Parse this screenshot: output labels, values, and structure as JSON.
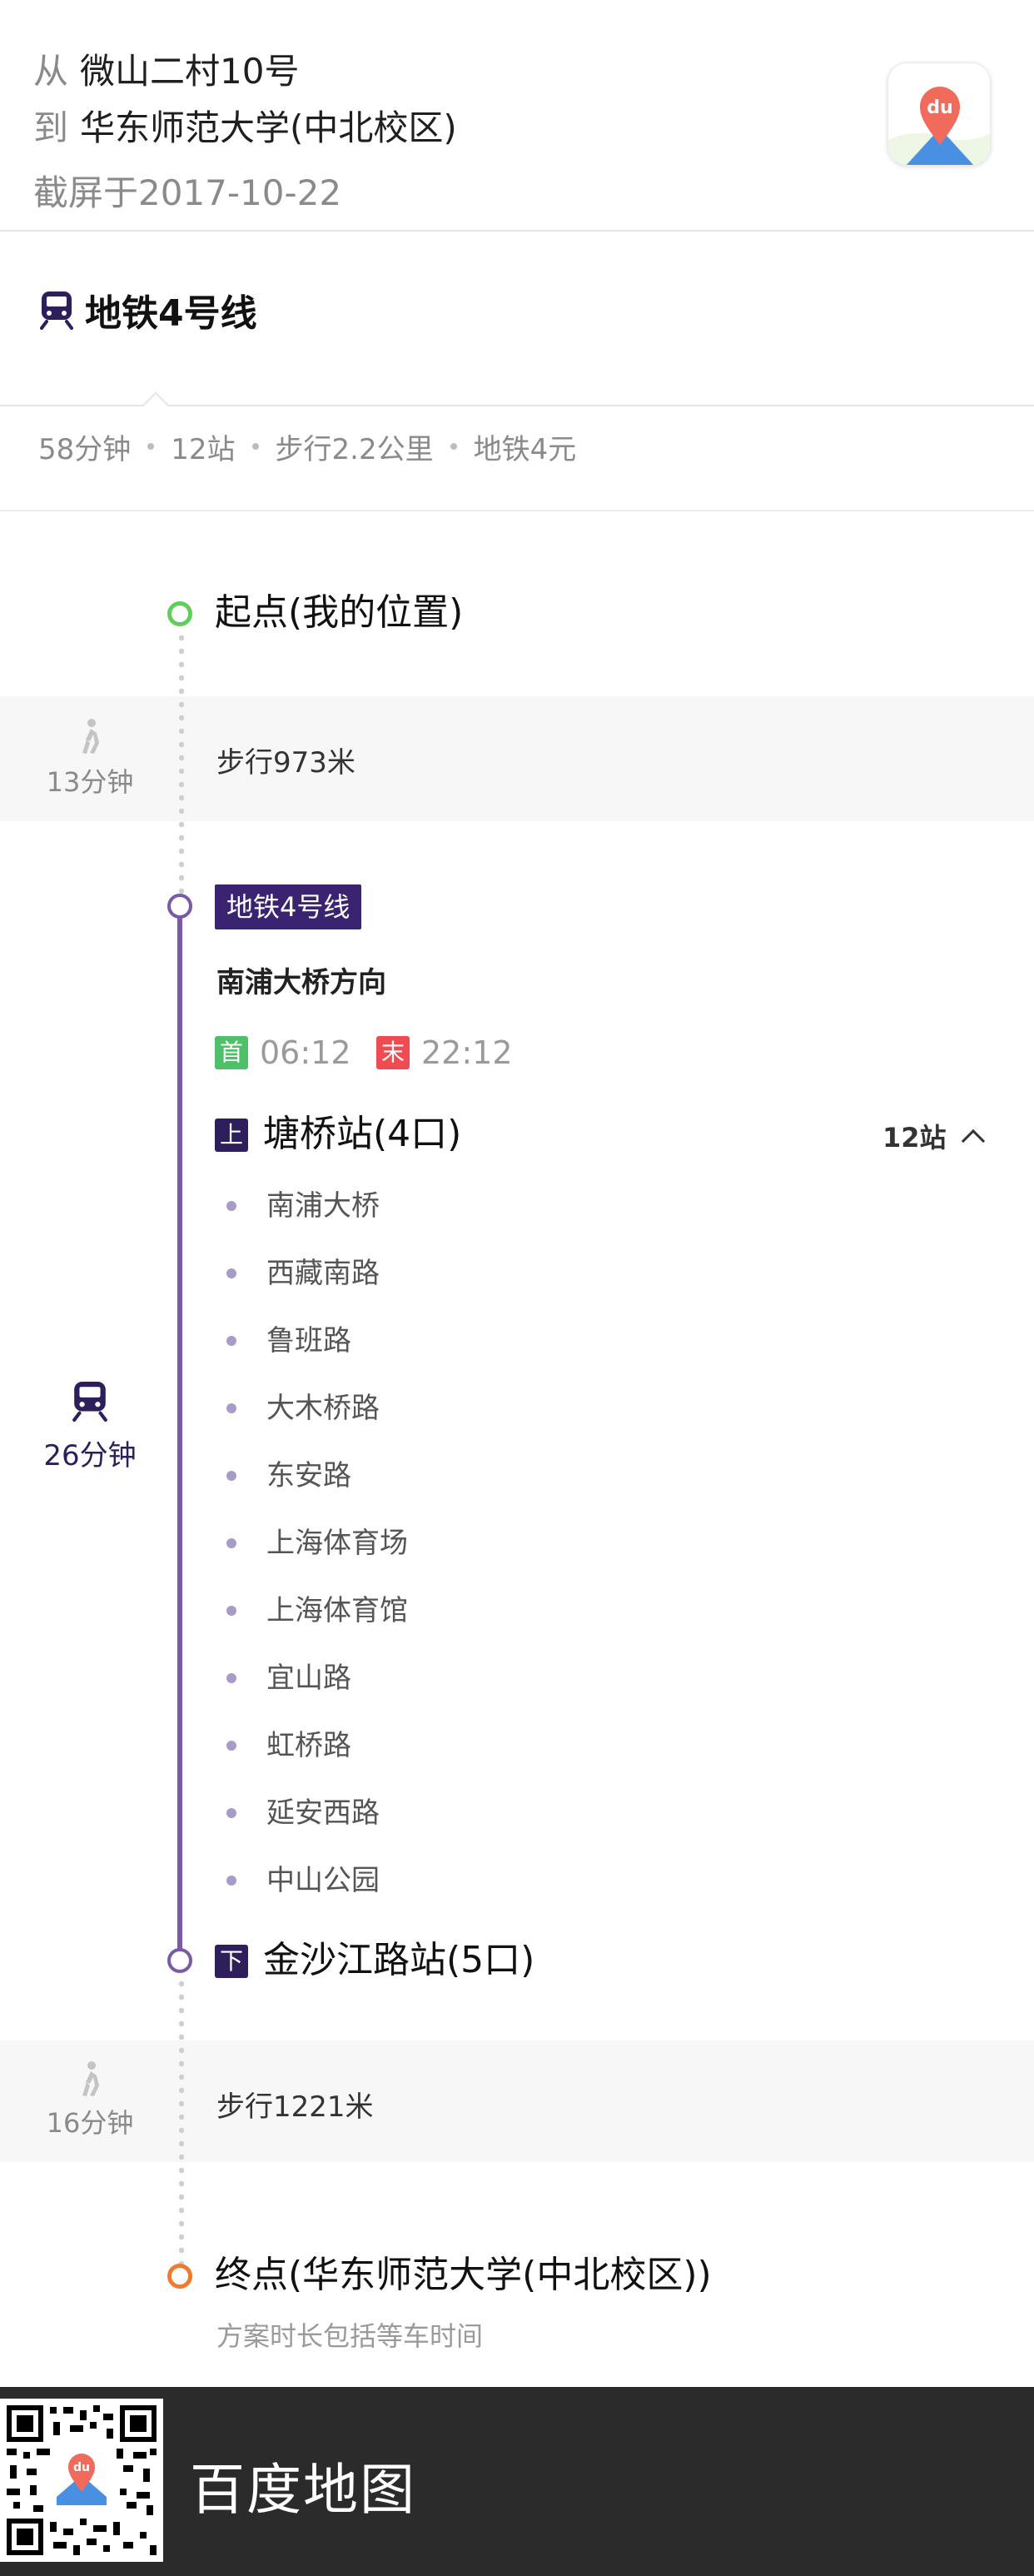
{
  "header": {
    "from_prefix": "从",
    "from_text": "微山二村10号",
    "to_prefix": "到",
    "to_text": "华东师范大学(中北校区)",
    "captured": "截屏于2017-10-22",
    "logo_text": "du"
  },
  "route": {
    "title": "地铁4号线",
    "summary": {
      "duration": "58分钟",
      "stops": "12站",
      "walk": "步行2.2公里",
      "fare": "地铁4元"
    }
  },
  "timeline": {
    "start_label": "起点(我的位置)",
    "walk1": {
      "time": "13分钟",
      "distance": "步行973米"
    },
    "metro": {
      "line": "地铁4号线",
      "direction": "南浦大桥方向",
      "first_label": "首",
      "first_time": "06:12",
      "last_label": "末",
      "last_time": "22:12",
      "board_label": "上",
      "board_station": "塘桥站(4口)",
      "stops_count": "12站",
      "intermediate_stops": [
        "南浦大桥",
        "西藏南路",
        "鲁班路",
        "大木桥路",
        "东安路",
        "上海体育场",
        "上海体育馆",
        "宜山路",
        "虹桥路",
        "延安西路",
        "中山公园"
      ],
      "alight_label": "下",
      "alight_station": "金沙江路站(5口)",
      "ride_time": "26分钟"
    },
    "walk2": {
      "time": "16分钟",
      "distance": "步行1221米"
    },
    "end_label": "终点(华东师范大学(中北校区))",
    "note": "方案时长包括等车时间"
  },
  "footer": {
    "logo_text": "du",
    "title": "百度地图"
  },
  "colors": {
    "metro_line": "#7a5aa6",
    "line_badge": "#3a2370",
    "start_node": "#5fcf5a",
    "end_node": "#f07a2e",
    "first_badge": "#4fbf6a",
    "last_badge": "#ef4b52"
  }
}
